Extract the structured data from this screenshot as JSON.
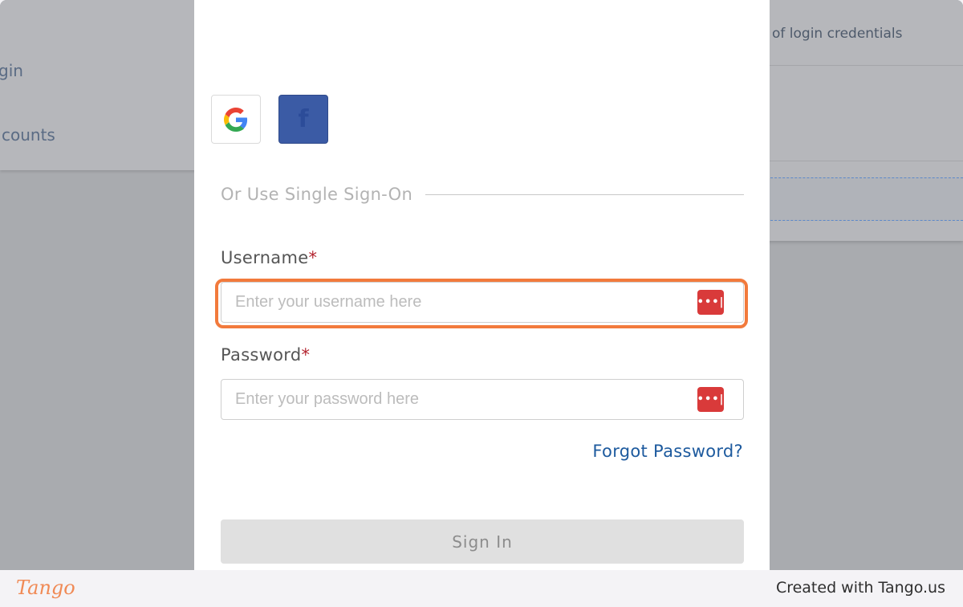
{
  "background": {
    "left_items": [
      "gin",
      "counts"
    ],
    "right_text": "of login credentials"
  },
  "login": {
    "social": {
      "google_icon": "google-g-icon",
      "facebook_icon": "facebook-f-icon",
      "facebook_glyph": "f"
    },
    "sso_divider_text": "Or Use Single Sign-On",
    "username": {
      "label": "Username",
      "required_mark": "*",
      "placeholder": "Enter your username here"
    },
    "password": {
      "label": "Password",
      "required_mark": "*",
      "placeholder": "Enter your password here"
    },
    "password_manager_icon": "lastpass-icon",
    "password_manager_glyph": "•••|",
    "forgot_password_label": "Forgot Password?",
    "sign_in_label": "Sign In"
  },
  "footer": {
    "logo": "Tango",
    "credit": "Created with Tango.us"
  },
  "colors": {
    "highlight": "#f27a3c",
    "link": "#1d5a9e",
    "facebook": "#3b5ba5",
    "lastpass": "#d93a3a",
    "required": "#b3242f"
  }
}
